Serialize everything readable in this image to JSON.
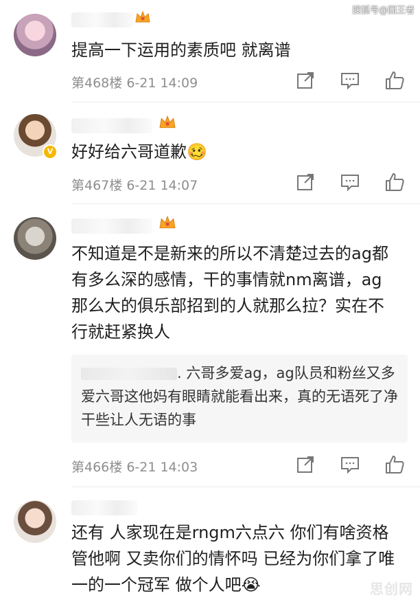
{
  "watermarks": {
    "top": "搜狐号@囧王者",
    "bottom": "思创网"
  },
  "icons": {
    "share": "share-icon",
    "comment": "comment-icon",
    "like": "thumbs-up-icon",
    "crown": "crown-icon",
    "verified": "verified-badge-icon"
  },
  "comments": [
    {
      "text": "提高一下运用的素质吧 就离谱",
      "floor": "第468楼",
      "time": "6-21 14:09"
    },
    {
      "text": "好好给六哥道歉🥴",
      "floor": "第467楼",
      "time": "6-21 14:07"
    },
    {
      "text": "不知道是不是新来的所以不清楚过去的ag都有多么深的感情，干的事情就nm离谱，ag那么大的俱乐部招到的人就那么拉？实在不行就赶紧换人",
      "quote": ". 六哥多爱ag，ag队员和粉丝又多爱六哥这他妈有眼睛就能看出来，真的无语死了净干些让人无语的事",
      "floor": "第466楼",
      "time": "6-21 14:03"
    },
    {
      "text": "还有 人家现在是rngm六点六 你们有啥资格管他啊 又卖你们的情怀吗 已经为你们拿了唯一的一个冠军 做个人吧😭"
    }
  ]
}
